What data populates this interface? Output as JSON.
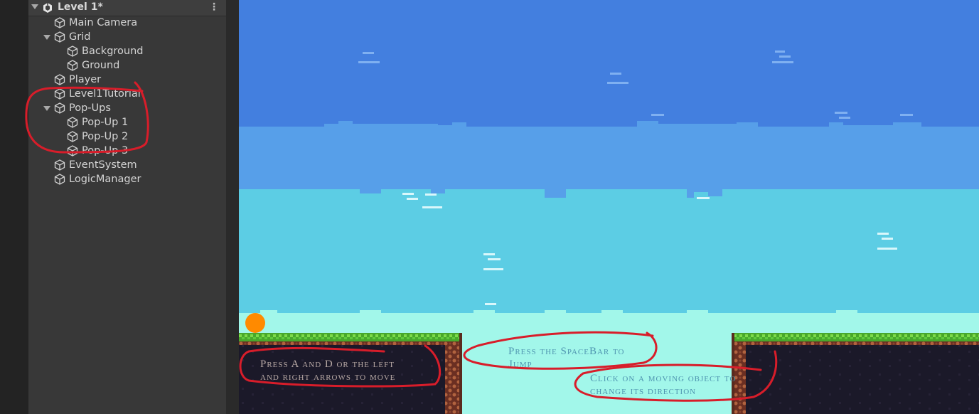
{
  "hierarchy": {
    "scene_title": "Level 1*",
    "menu_icon": "kebab-menu-icon",
    "items": [
      {
        "label": "Main Camera",
        "icon": "gameobject-cube-icon"
      },
      {
        "label": "Grid",
        "icon": "gameobject-cube-icon",
        "expanded": true
      },
      {
        "label": "Background",
        "icon": "gameobject-cube-icon"
      },
      {
        "label": "Ground",
        "icon": "gameobject-cube-icon"
      },
      {
        "label": "Player",
        "icon": "gameobject-cube-icon"
      },
      {
        "label": "Level1Tutorial",
        "icon": "gameobject-cube-icon"
      },
      {
        "label": "Pop-Ups",
        "icon": "gameobject-cube-icon",
        "expanded": true
      },
      {
        "label": "Pop-Up 1",
        "icon": "gameobject-cube-icon"
      },
      {
        "label": "Pop-Up 2",
        "icon": "gameobject-cube-icon"
      },
      {
        "label": "Pop-Up 3",
        "icon": "gameobject-cube-icon"
      },
      {
        "label": "EventSystem",
        "icon": "gameobject-cube-icon"
      },
      {
        "label": "LogicManager",
        "icon": "gameobject-cube-icon"
      }
    ]
  },
  "game": {
    "tutorial_text": {
      "move": [
        "Press A and D or the left",
        "and right arrows to move"
      ],
      "jump": [
        "Press the SpaceBar to",
        "Jump"
      ],
      "direction": [
        "Click on a moving object to",
        "change its direction"
      ]
    },
    "colors": {
      "sky_top": "#437fdf",
      "sky_mid": "#579fe9",
      "sky_low": "#5ccde4",
      "horizon": "#a2f7ea",
      "grass": "#5fcb3c",
      "dirt": "#1b1929",
      "rock_edge": "#a5583c",
      "player": "#ff8a00",
      "annotation": "#d81d2a"
    }
  }
}
